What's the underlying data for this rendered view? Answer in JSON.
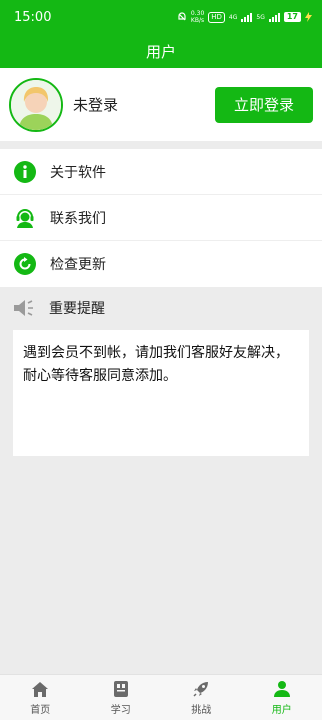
{
  "status_bar": {
    "time": "15:00",
    "net_speed_top": "0.30",
    "net_speed_bottom": "KB/s",
    "hd_label": "HD",
    "net_4g": "4G",
    "net_5g": "5G",
    "battery": "17"
  },
  "header": {
    "title": "用户"
  },
  "profile": {
    "username": "未登录",
    "login_button": "立即登录"
  },
  "menu": {
    "items": [
      {
        "label": "关于软件",
        "icon": "info-icon"
      },
      {
        "label": "联系我们",
        "icon": "support-icon"
      },
      {
        "label": "检查更新",
        "icon": "refresh-icon"
      }
    ]
  },
  "notice": {
    "title": "重要提醒",
    "text": "遇到会员不到帐，请加我们客服好友解决，耐心等待客服同意添加。"
  },
  "tabbar": {
    "tabs": [
      {
        "label": "首页",
        "icon": "home-icon"
      },
      {
        "label": "学习",
        "icon": "book-icon"
      },
      {
        "label": "挑战",
        "icon": "rocket-icon"
      },
      {
        "label": "用户",
        "icon": "user-icon"
      }
    ],
    "active_index": 3
  },
  "colors": {
    "accent": "#14b814",
    "background": "#ececec"
  }
}
